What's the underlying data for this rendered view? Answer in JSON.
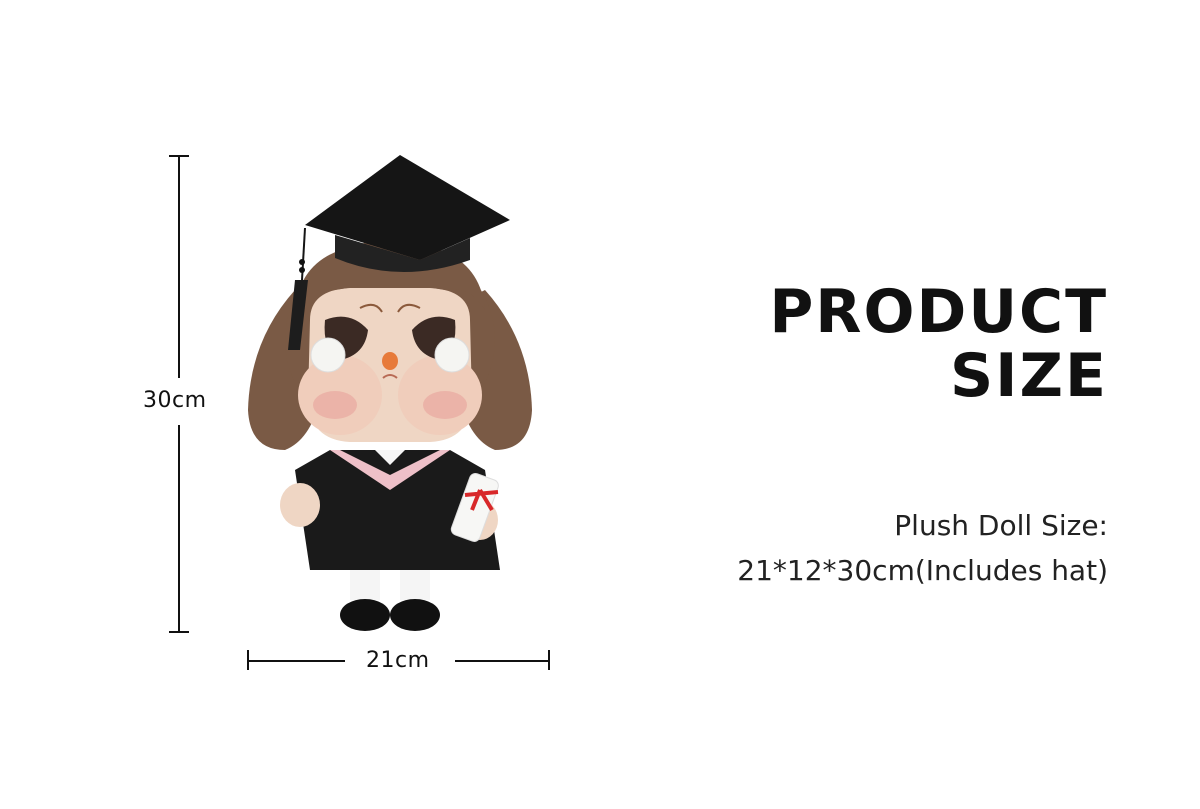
{
  "dimensions": {
    "height_label": "30cm",
    "width_label": "21cm"
  },
  "product": {
    "image_name": "graduation-plush-doll",
    "colors": {
      "hair": "#7a5a45",
      "skin": "#efd6c4",
      "gown": "#1a1a1a",
      "collar": "#eec0c8",
      "cheek": "#e8a8a0",
      "ribbon": "#d8282a"
    }
  },
  "heading": {
    "line1": "PRODUCT",
    "line2": "SIZE"
  },
  "description": {
    "line1": "Plush Doll Size:",
    "line2": "21*12*30cm(Includes hat)"
  }
}
